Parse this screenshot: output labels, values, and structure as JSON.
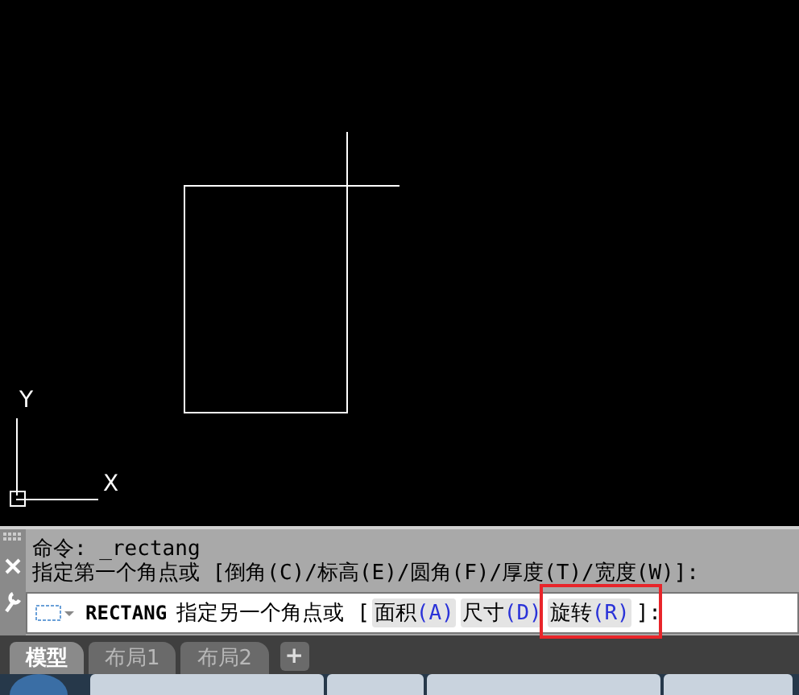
{
  "canvas": {
    "ucs_y": "Y",
    "ucs_x": "X"
  },
  "command": {
    "history": [
      "命令: _rectang",
      "指定第一个角点或 [倒角(C)/标高(E)/圆角(F)/厚度(T)/宽度(W)]:"
    ],
    "input": {
      "command": "RECTANG",
      "prompt": "指定另一个角点或",
      "open": "[",
      "close": "]:",
      "options": [
        {
          "label": "面积",
          "key": "(A)",
          "highlighted": false
        },
        {
          "label": "尺寸",
          "key": "(D)",
          "highlighted": false
        },
        {
          "label": "旋转",
          "key": "(R)",
          "highlighted": true
        }
      ]
    }
  },
  "tabs": [
    {
      "label": "模型",
      "selected": true
    },
    {
      "label": "布局1",
      "selected": false
    },
    {
      "label": "布局2",
      "selected": false
    }
  ],
  "add_tab": "+"
}
